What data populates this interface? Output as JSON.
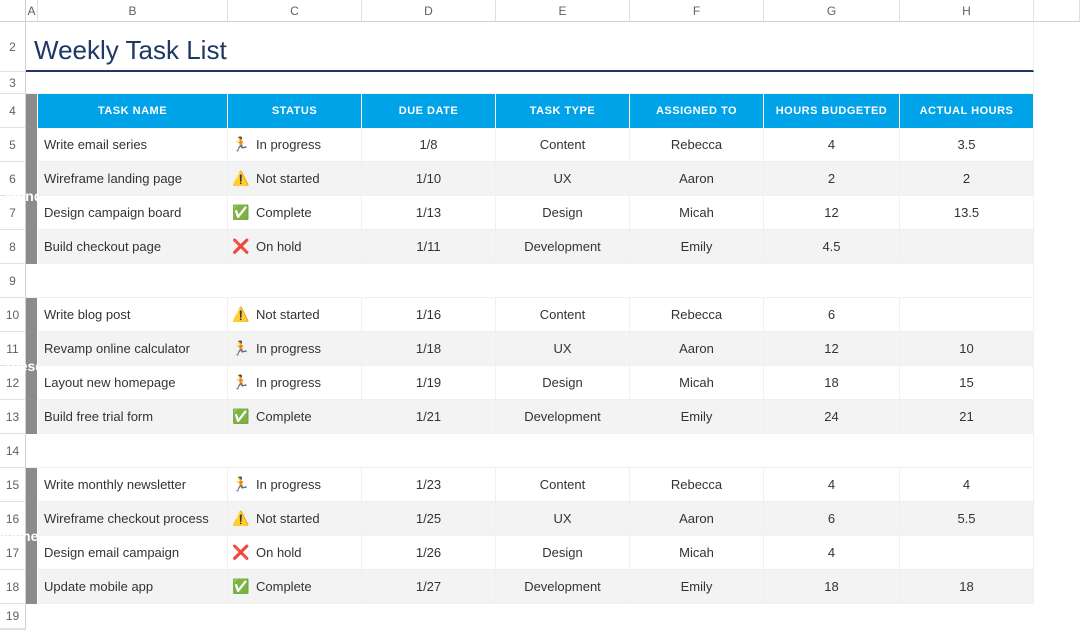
{
  "column_letters": [
    "A",
    "B",
    "C",
    "D",
    "E",
    "F",
    "G",
    "H"
  ],
  "row_numbers": [
    "2",
    "3",
    "4",
    "5",
    "6",
    "7",
    "8",
    "9",
    "10",
    "11",
    "12",
    "13",
    "14",
    "15",
    "16",
    "17",
    "18",
    "19"
  ],
  "title": "Weekly Task List",
  "headers": {
    "task_name": "TASK NAME",
    "status": "STATUS",
    "due_date": "DUE DATE",
    "task_type": "TASK TYPE",
    "assigned_to": "ASSIGNED TO",
    "hours_budgeted": "HOURS BUDGETED",
    "actual_hours": "ACTUAL HOURS"
  },
  "status_icons": {
    "in_progress": "🏃",
    "not_started": "⚠️",
    "complete": "✅",
    "on_hold": "❌"
  },
  "days": [
    {
      "label": "Monday",
      "tasks": [
        {
          "name": "Write email series",
          "status_key": "in_progress",
          "status": "In progress",
          "due": "1/8",
          "type": "Content",
          "assigned": "Rebecca",
          "budget": "4",
          "actual": "3.5",
          "shade": false
        },
        {
          "name": "Wireframe landing page",
          "status_key": "not_started",
          "status": "Not started",
          "due": "1/10",
          "type": "UX",
          "assigned": "Aaron",
          "budget": "2",
          "actual": "2",
          "shade": true
        },
        {
          "name": "Design campaign board",
          "status_key": "complete",
          "status": "Complete",
          "due": "1/13",
          "type": "Design",
          "assigned": "Micah",
          "budget": "12",
          "actual": "13.5",
          "shade": false
        },
        {
          "name": "Build checkout page",
          "status_key": "on_hold",
          "status": "On hold",
          "due": "1/11",
          "type": "Development",
          "assigned": "Emily",
          "budget": "4.5",
          "actual": "",
          "shade": true
        }
      ]
    },
    {
      "label": "Tuesday",
      "tasks": [
        {
          "name": "Write blog post",
          "status_key": "not_started",
          "status": "Not started",
          "due": "1/16",
          "type": "Content",
          "assigned": "Rebecca",
          "budget": "6",
          "actual": "",
          "shade": false
        },
        {
          "name": "Revamp online calculator",
          "status_key": "in_progress",
          "status": "In progress",
          "due": "1/18",
          "type": "UX",
          "assigned": "Aaron",
          "budget": "12",
          "actual": "10",
          "shade": true
        },
        {
          "name": "Layout new homepage",
          "status_key": "in_progress",
          "status": "In progress",
          "due": "1/19",
          "type": "Design",
          "assigned": "Micah",
          "budget": "18",
          "actual": "15",
          "shade": false
        },
        {
          "name": "Build free trial form",
          "status_key": "complete",
          "status": "Complete",
          "due": "1/21",
          "type": "Development",
          "assigned": "Emily",
          "budget": "24",
          "actual": "21",
          "shade": true
        }
      ]
    },
    {
      "label": "Wednesday",
      "tasks": [
        {
          "name": "Write monthly newsletter",
          "status_key": "in_progress",
          "status": "In progress",
          "due": "1/23",
          "type": "Content",
          "assigned": "Rebecca",
          "budget": "4",
          "actual": "4",
          "shade": false
        },
        {
          "name": "Wireframe checkout process",
          "status_key": "not_started",
          "status": "Not started",
          "due": "1/25",
          "type": "UX",
          "assigned": "Aaron",
          "budget": "6",
          "actual": "5.5",
          "shade": true
        },
        {
          "name": "Design email campaign",
          "status_key": "on_hold",
          "status": "On hold",
          "due": "1/26",
          "type": "Design",
          "assigned": "Micah",
          "budget": "4",
          "actual": "",
          "shade": false
        },
        {
          "name": "Update mobile app",
          "status_key": "complete",
          "status": "Complete",
          "due": "1/27",
          "type": "Development",
          "assigned": "Emily",
          "budget": "18",
          "actual": "18",
          "shade": true
        }
      ]
    }
  ]
}
